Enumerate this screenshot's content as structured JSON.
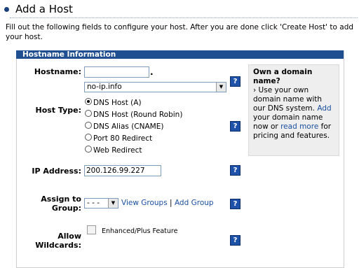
{
  "page": {
    "title": "Add a Host",
    "intro": "Fill out the following fields to configure your host. After you are done click 'Create Host' to add your host."
  },
  "panel": {
    "header": "Hostname Information"
  },
  "hostname": {
    "label": "Hostname:",
    "value": "",
    "dot": ".",
    "domain_selected": "no-ip.info",
    "help_label": "?"
  },
  "host_type": {
    "label": "Host Type:",
    "options": [
      {
        "label": "DNS Host (A)",
        "checked": true
      },
      {
        "label": "DNS Host (Round Robin)",
        "checked": false
      },
      {
        "label": "DNS Alias (CNAME)",
        "checked": false
      },
      {
        "label": "Port 80 Redirect",
        "checked": false
      },
      {
        "label": "Web Redirect",
        "checked": false
      }
    ],
    "help_label": "?"
  },
  "ip_address": {
    "label": "IP Address:",
    "value": "200.126.99.227",
    "help_label": "?"
  },
  "assign_group": {
    "label_line1": "Assign to",
    "label_line2": "Group:",
    "selected": "- - -",
    "view_groups": "View Groups",
    "separator": "|",
    "add_group": "Add Group",
    "help_label": "?"
  },
  "wildcards": {
    "label_line1": "Allow",
    "label_line2": "Wildcards:",
    "checked": false,
    "feature_note": "Enhanced/Plus Feature",
    "help_label": "?"
  },
  "sidebar": {
    "title": "Own a domain name?",
    "arrow": "›",
    "text_before_add": "Use your own domain name with our DNS system.",
    "add_link": "Add",
    "text_middle": "your domain name now or",
    "read_more_link": "read more",
    "text_after": "for pricing and features."
  },
  "colors": {
    "header_bg": "#1f4e91",
    "help_button": "#1e52a8",
    "link": "#1a4fa0",
    "sidebar_bg": "#eeeeee"
  },
  "icons": [
    "bullet-icon",
    "help-icon",
    "dropdown-arrow-icon",
    "radio-icon",
    "checkbox-icon"
  ]
}
